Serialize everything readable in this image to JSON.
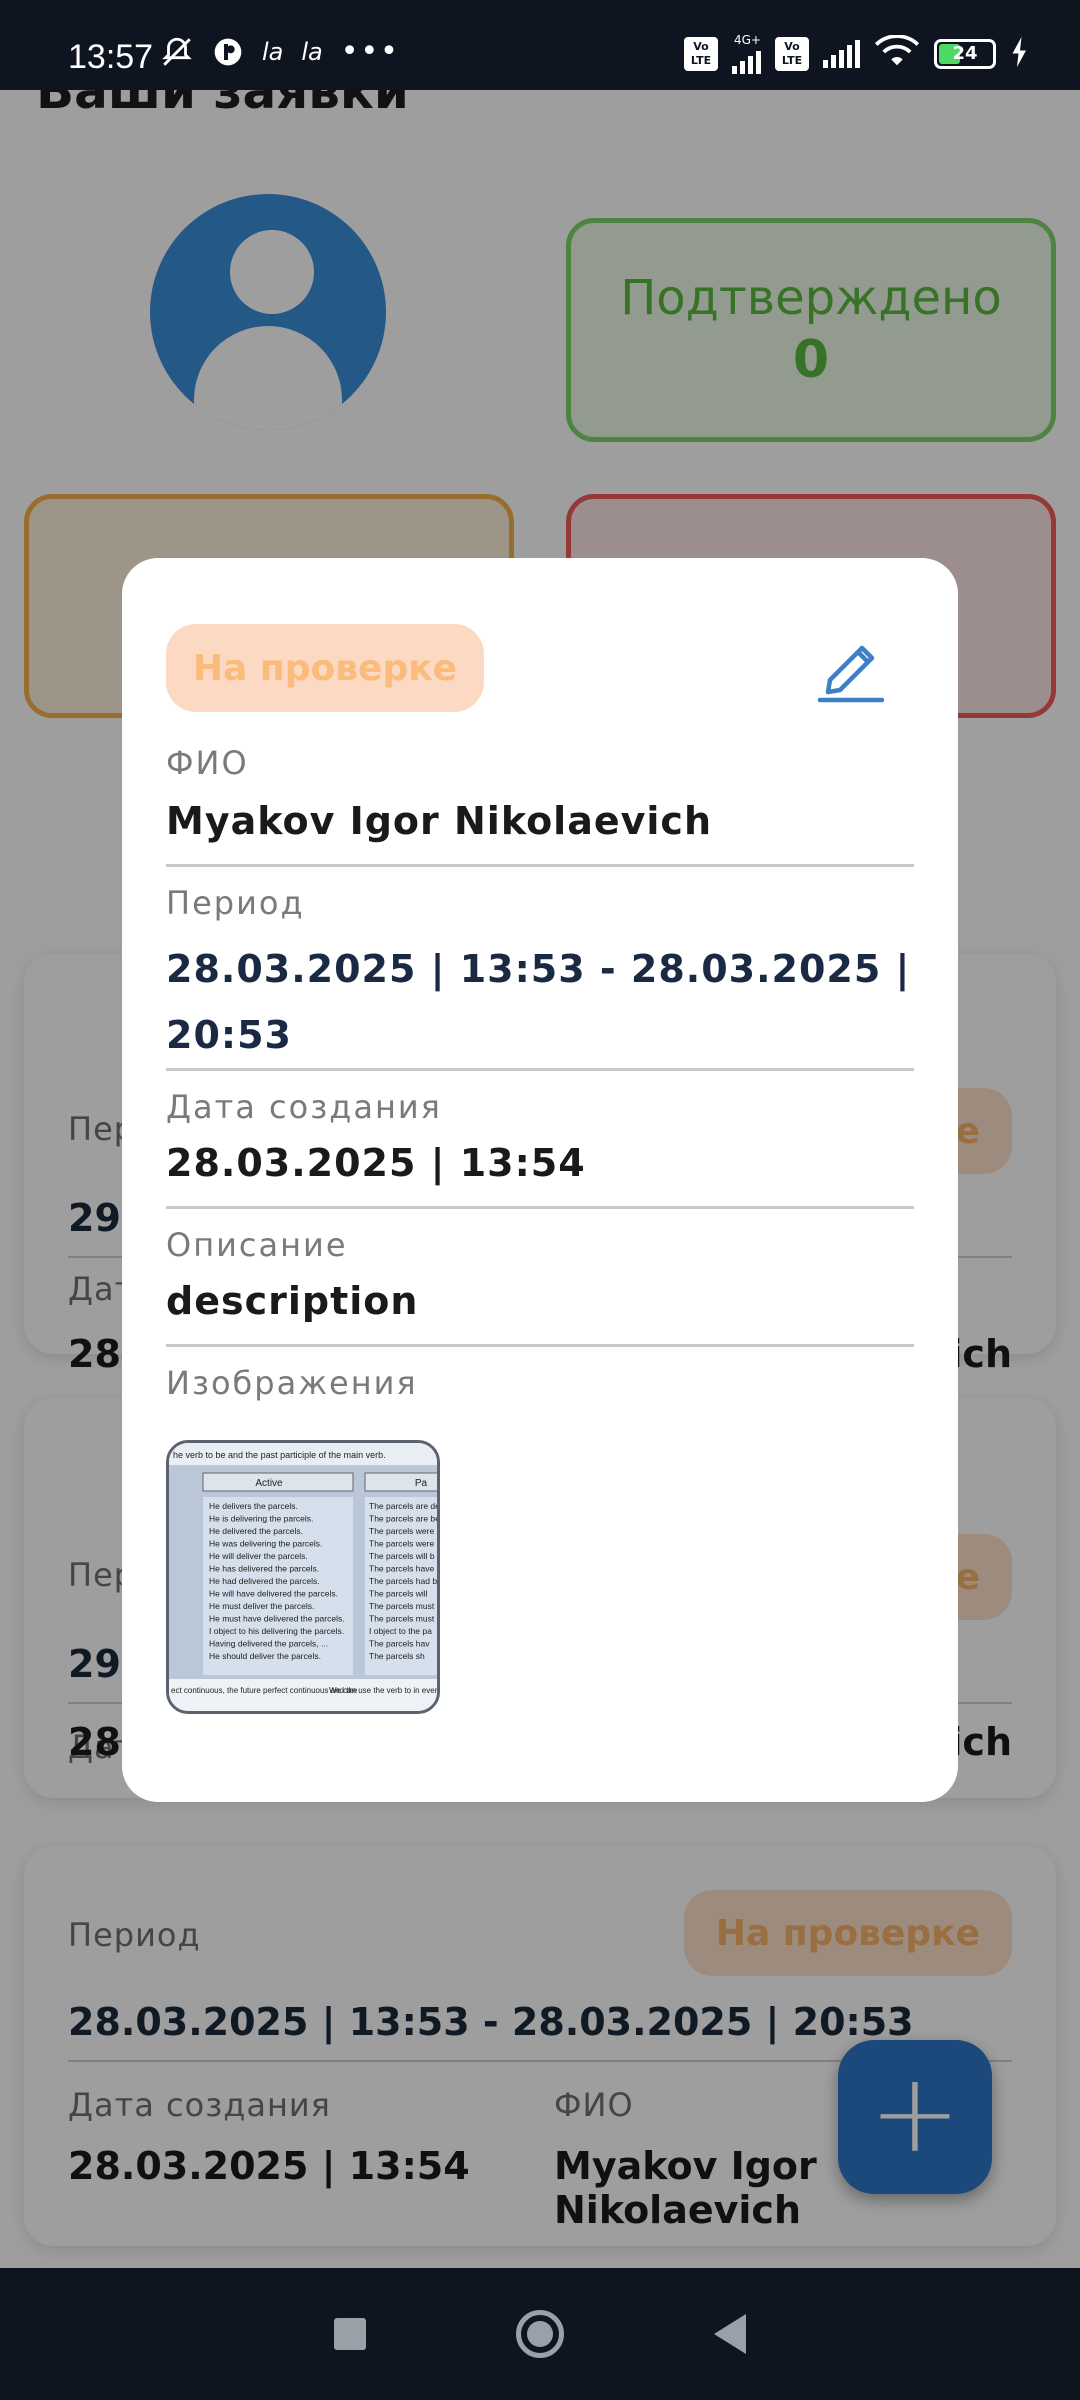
{
  "status_bar": {
    "time": "13:57",
    "left_icons": [
      "bell-off-icon",
      "p-icon",
      "la",
      "la",
      "more-icon"
    ],
    "right_icons": [
      "volte-icon",
      "signal-4g-icon",
      "volte-icon",
      "signal-icon",
      "wifi-icon",
      "battery-icon"
    ],
    "network_label": "4G+",
    "volte_label": "Vo LTE",
    "battery_level": "24"
  },
  "page": {
    "title": "Ваши заявки",
    "stats": {
      "confirmed_label": "Подтверждено",
      "confirmed_value": "0"
    },
    "cards": [
      {
        "period_label": "Пер",
        "period_value": "29.",
        "created_label": "Дат",
        "created_value": "28.",
        "badge": "е",
        "fio_value": "ich"
      },
      {
        "period_label": "Пер",
        "period_value": "29.",
        "created_label": "Дат",
        "created_value": "28.",
        "badge": "е",
        "fio_value": "ich"
      },
      {
        "period_label": "Период",
        "badge": "На проверке",
        "period_value": "28.03.2025 | 13:53 - 28.03.2025 | 20:53",
        "created_label": "Дата создания",
        "created_value": "28.03.2025 | 13:54",
        "fio_label": "ФИО",
        "fio_value": "Myakov Igor Nikolaevich"
      }
    ],
    "fab_label": "+"
  },
  "modal": {
    "status_badge": "На проверке",
    "fio_label": "ФИО",
    "fio_value": "Myakov Igor Nikolaevich",
    "period_label": "Период",
    "period_value": "28.03.2025 | 13:53 - 28.03.2025 | 20:53",
    "created_label": "Дата создания",
    "created_value": "28.03.2025 | 13:54",
    "description_label": "Описание",
    "description_value": "description",
    "images_label": "Изображения",
    "thumbnail_text": {
      "heading": "he verb to be and the past participle of the main verb.",
      "col_active": "Active",
      "col_passive": "Pa",
      "active_rows": [
        "He delivers the parcels.",
        "He is delivering the parcels.",
        "He delivered the parcels.",
        "He was delivering the parcels.",
        "He will deliver the parcels.",
        "He has delivered the parcels.",
        "He had delivered the parcels.",
        "He will have delivered the parcels.",
        "He must deliver the parcels.",
        "He must have delivered the parcels.",
        "I object to his delivering the parcels.",
        "Having delivered the parcels, ...",
        "He should deliver the parcels."
      ],
      "passive_rows": [
        "The parcels are del",
        "The parcels are be",
        "The parcels were",
        "The parcels were b",
        "The parcels will b",
        "The parcels have",
        "The parcels had b",
        "The parcels will",
        "The parcels must",
        "The parcels must",
        "I object to the pa",
        "The parcels hav",
        "The parcels sh"
      ],
      "footer_left": "ect continuous, the future perfect continuous and the",
      "footer_right": "We can use the verb to in everyday speech"
    }
  },
  "nav": {
    "buttons": [
      "recents-button",
      "home-button",
      "back-button"
    ]
  }
}
